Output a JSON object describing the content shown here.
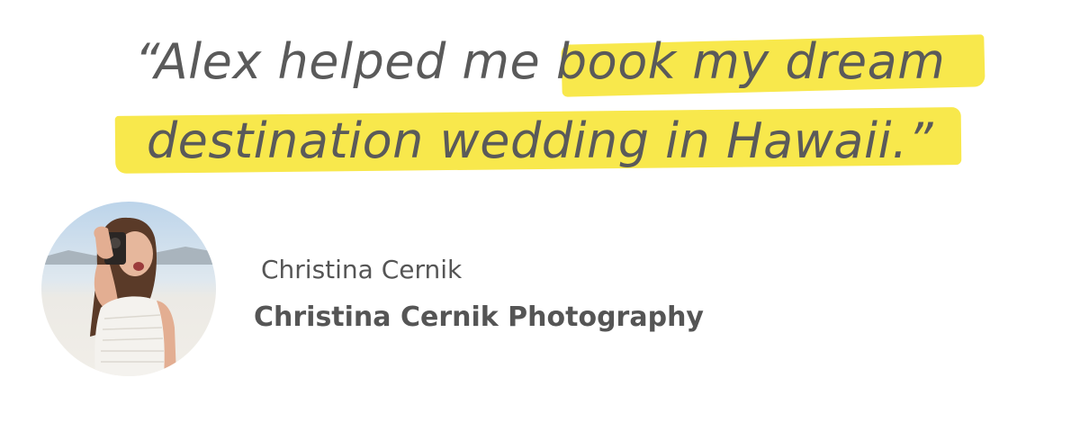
{
  "testimonial": {
    "quote_line_1_plain": "“Alex helped me ",
    "quote_line_1_highlight": "book my dream",
    "quote_line_2": "destination wedding in Hawaii.”",
    "highlight_color": "#f8e84c",
    "text_color": "#5a5a5a"
  },
  "author": {
    "name": "Christina Cernik",
    "company": "Christina Cernik Photography",
    "photo": "woman-with-camera-photo"
  }
}
